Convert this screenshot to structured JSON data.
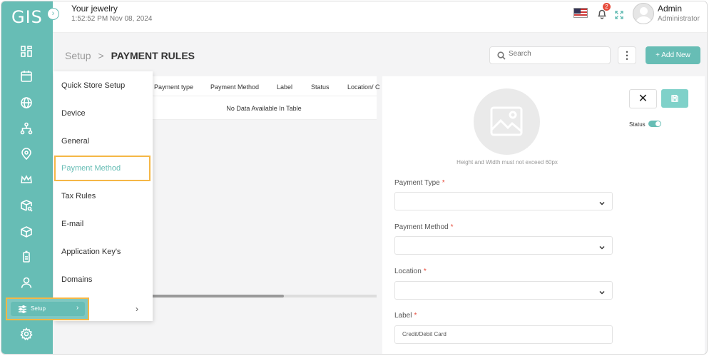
{
  "sidebar": {
    "logo_text": "GIS",
    "toggle_glyph": "›",
    "icons": [
      "dashboard-icon",
      "calendar-icon",
      "globe-icon",
      "hierarchy-icon",
      "location-icon",
      "crown-icon",
      "box-search-icon",
      "cube-icon",
      "battery-icon",
      "user-icon",
      "settings-icon"
    ],
    "setup": {
      "label": "Setup",
      "chevron": "›"
    }
  },
  "header": {
    "store_name": "Your jewelry",
    "datetime": "1:52:52 PM Nov 08, 2024",
    "notification_count": "2",
    "user_name": "Admin",
    "user_role": "Administrator"
  },
  "titlebar": {
    "breadcrumb_parent": "Setup",
    "breadcrumb_sep": ">",
    "page_title": "PAYMENT RULES",
    "search_placeholder": "Search",
    "more_glyph": "⋮",
    "add_label": "+ Add New"
  },
  "table": {
    "columns": [
      "Payment type",
      "Payment Method",
      "Label",
      "Status",
      "Location/ C"
    ],
    "empty_text": "No Data Available In Table"
  },
  "menu": {
    "items": [
      "Quick Store Setup",
      "Device",
      "General",
      "Payment Method",
      "Tax Rules",
      "E-mail",
      "Application Key's",
      "Domains"
    ],
    "active_index": 3,
    "chevron": "›"
  },
  "form": {
    "close_glyph": "✕",
    "status_label": "Status",
    "status_on": true,
    "image_hint": "Height and Width must not exceed 60px",
    "payment_type_label": "Payment Type",
    "payment_method_label": "Payment Method",
    "location_label": "Location",
    "label_label": "Label",
    "required_mark": "*",
    "label_placeholder": "Credit/Debit Card"
  },
  "colors": {
    "accent": "#67bdb5",
    "highlight": "#f5b746",
    "required": "#e74c3c"
  }
}
